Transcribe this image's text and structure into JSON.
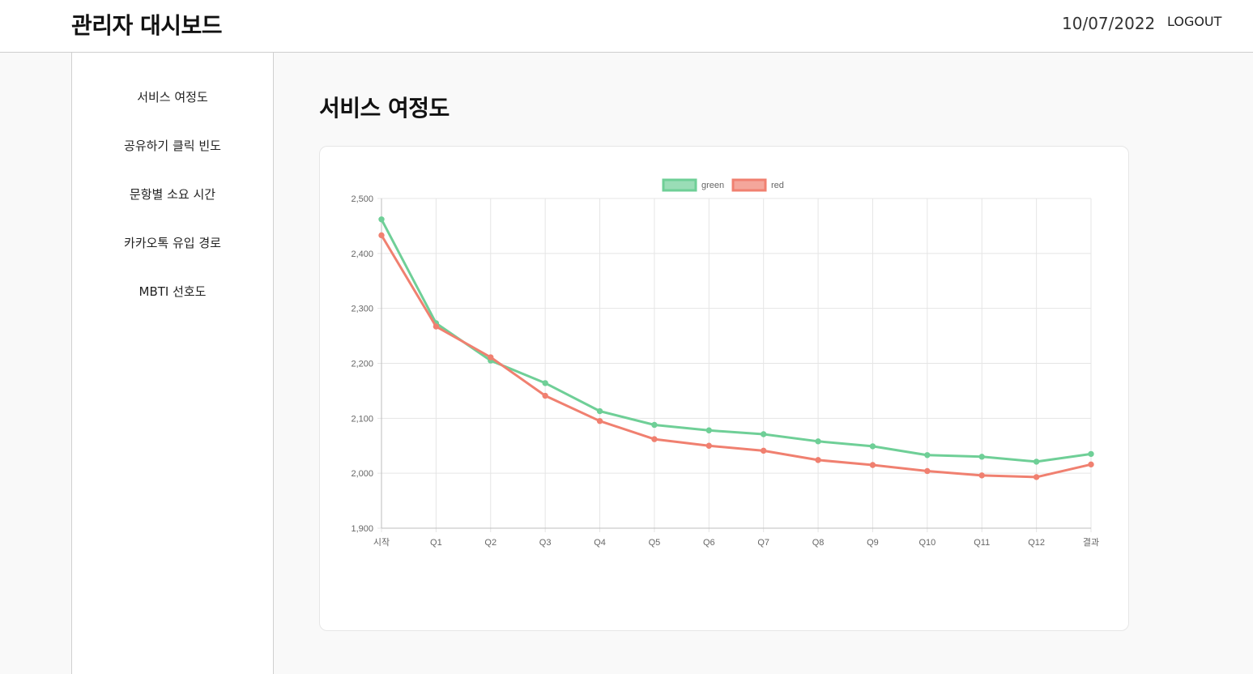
{
  "header": {
    "title": "관리자 대시보드",
    "date": "10/07/2022",
    "logout_label": "LOGOUT"
  },
  "sidebar": {
    "items": [
      {
        "label": "서비스 여정도"
      },
      {
        "label": "공유하기 클릭 빈도"
      },
      {
        "label": "문항별 소요 시간"
      },
      {
        "label": "카카오톡 유입 경로"
      },
      {
        "label": "MBTI 선호도"
      }
    ]
  },
  "main": {
    "page_title": "서비스 여정도"
  },
  "chart_data": {
    "type": "line",
    "title": "",
    "xlabel": "",
    "ylabel": "",
    "categories": [
      "시작",
      "Q1",
      "Q2",
      "Q3",
      "Q4",
      "Q5",
      "Q6",
      "Q7",
      "Q8",
      "Q9",
      "Q10",
      "Q11",
      "Q12",
      "결과"
    ],
    "ylim": [
      1900,
      2500
    ],
    "yticks": [
      "1,900",
      "2,000",
      "2,100",
      "2,200",
      "2,300",
      "2,400",
      "2,500"
    ],
    "grid": true,
    "legend_position": "top",
    "series": [
      {
        "name": "green",
        "color": "#6fcf97",
        "values": [
          2462,
          2273,
          2205,
          2164,
          2113,
          2088,
          2078,
          2071,
          2058,
          2049,
          2033,
          2030,
          2021,
          2035
        ]
      },
      {
        "name": "red",
        "color": "#f08070",
        "values": [
          2433,
          2267,
          2211,
          2141,
          2095,
          2062,
          2050,
          2041,
          2024,
          2015,
          2004,
          1996,
          1993,
          2016
        ]
      }
    ]
  }
}
